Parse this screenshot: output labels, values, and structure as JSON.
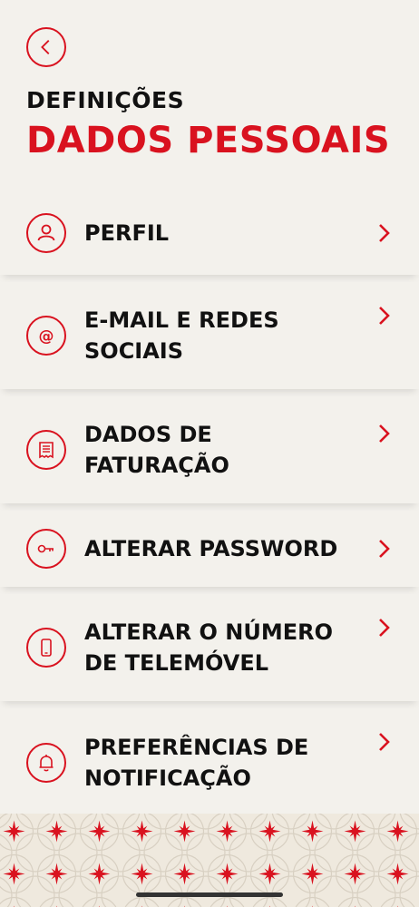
{
  "header": {
    "subtitle": "DEFINIÇÕES",
    "title": "DADOS PESSOAIS"
  },
  "menu": [
    {
      "label": "PERFIL",
      "icon": "user-icon"
    },
    {
      "label": "E-MAIL E REDES SOCIAIS",
      "icon": "at-icon"
    },
    {
      "label": "DADOS DE FATURAÇÃO",
      "icon": "receipt-icon"
    },
    {
      "label": "ALTERAR PASSWORD",
      "icon": "key-icon"
    },
    {
      "label": "ALTERAR O NÚMERO DE TELEMÓVEL",
      "icon": "phone-icon"
    },
    {
      "label": "PREFERÊNCIAS DE NOTIFICAÇÃO",
      "icon": "bell-icon"
    }
  ],
  "colors": {
    "accent": "#d9121f",
    "background": "#f3f1ec",
    "text": "#111111"
  }
}
